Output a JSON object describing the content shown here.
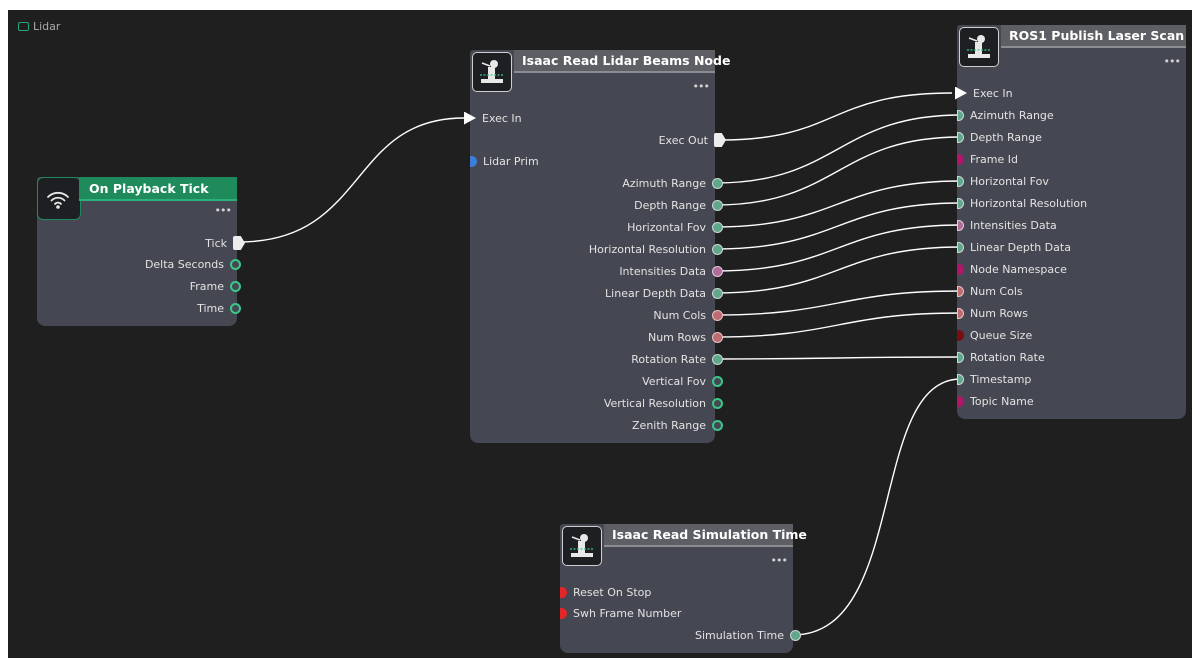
{
  "graph": {
    "title": "Lidar"
  },
  "nodes": {
    "playback_tick": {
      "title": "On Playback Tick",
      "menu": "•••",
      "outputs": [
        "Tick",
        "Delta Seconds",
        "Frame",
        "Time"
      ]
    },
    "read_lidar": {
      "title": "Isaac Read Lidar Beams Node",
      "menu": "•••",
      "exec_in": "Exec In",
      "exec_out": "Exec Out",
      "input_prim": "Lidar Prim",
      "outputs": [
        "Azimuth Range",
        "Depth Range",
        "Horizontal Fov",
        "Horizontal Resolution",
        "Intensities Data",
        "Linear Depth Data",
        "Num Cols",
        "Num Rows",
        "Rotation Rate",
        "Vertical Fov",
        "Vertical Resolution",
        "Zenith Range"
      ]
    },
    "publish_scan": {
      "title": "ROS1 Publish Laser Scan",
      "menu": "•••",
      "inputs": [
        "Exec In",
        "Azimuth Range",
        "Depth Range",
        "Frame Id",
        "Horizontal Fov",
        "Horizontal Resolution",
        "Intensities Data",
        "Linear Depth Data",
        "Node Namespace",
        "Num Cols",
        "Num Rows",
        "Queue Size",
        "Rotation Rate",
        "Timestamp",
        "Topic Name"
      ]
    },
    "sim_time": {
      "title": "Isaac Read Simulation Time",
      "menu": "•••",
      "inputs": [
        "Reset On Stop",
        "Swh Frame Number"
      ],
      "output": "Simulation Time"
    }
  },
  "colors": {
    "canvas": "#1f1f1f",
    "node_body": "#454852",
    "event_header": "#1f8a5b",
    "wire": "#ffffff"
  }
}
